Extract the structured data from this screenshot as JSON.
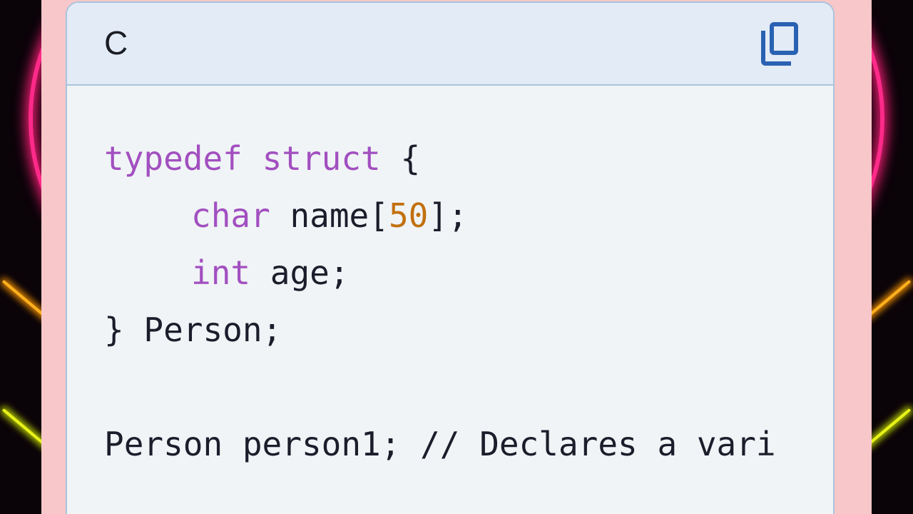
{
  "code_block": {
    "language": "C",
    "copy_icon": "copy-icon",
    "colors": {
      "keyword": "#a24fc0",
      "number": "#c2700f",
      "text": "#1b1d2b",
      "header_bg": "#e3ebf6",
      "body_bg": "#f0f4f6",
      "frame": "#f7c7c9",
      "icon": "#2a62b3"
    },
    "lines": [
      {
        "kw1": "typedef",
        "kw2": "struct",
        "rest": " {"
      },
      {
        "kw": "char",
        "text": " name[",
        "num": "50",
        "tail": "];"
      },
      {
        "kw": "int",
        "text": " age;"
      },
      {
        "text": "} Person;"
      },
      {
        "text": ""
      },
      {
        "text": "Person person1; // Declares a vari"
      }
    ]
  }
}
